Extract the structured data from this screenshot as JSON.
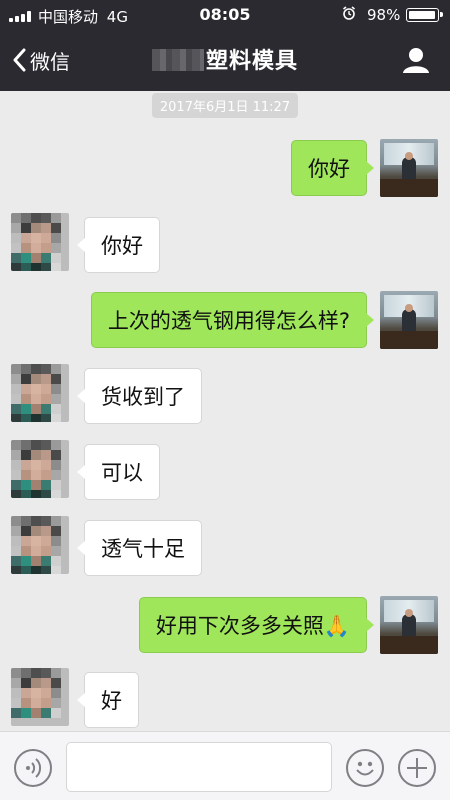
{
  "status_bar": {
    "carrier": "中国移动",
    "network": "4G",
    "time": "08:05",
    "battery": "98%",
    "battery_level": 0.98
  },
  "nav": {
    "back_label": "微信",
    "title": "塑料模具"
  },
  "timestamp": "2017年6月1日 11:27",
  "messages": [
    {
      "from": "self",
      "text": "你好"
    },
    {
      "from": "other",
      "text": "你好"
    },
    {
      "from": "self",
      "text": "上次的透气钢用得怎么样?"
    },
    {
      "from": "other",
      "text": "货收到了"
    },
    {
      "from": "other",
      "text": "可以"
    },
    {
      "from": "other",
      "text": "透气十足"
    },
    {
      "from": "self",
      "text": "好用下次多多关照🙏"
    },
    {
      "from": "other",
      "text": "好"
    }
  ],
  "input": {
    "value": "",
    "placeholder": ""
  },
  "colors": {
    "nav_bg": "#2b2a30",
    "chat_bg": "#ebebeb",
    "outgoing_bubble": "#9fe65a",
    "incoming_bubble": "#ffffff"
  }
}
